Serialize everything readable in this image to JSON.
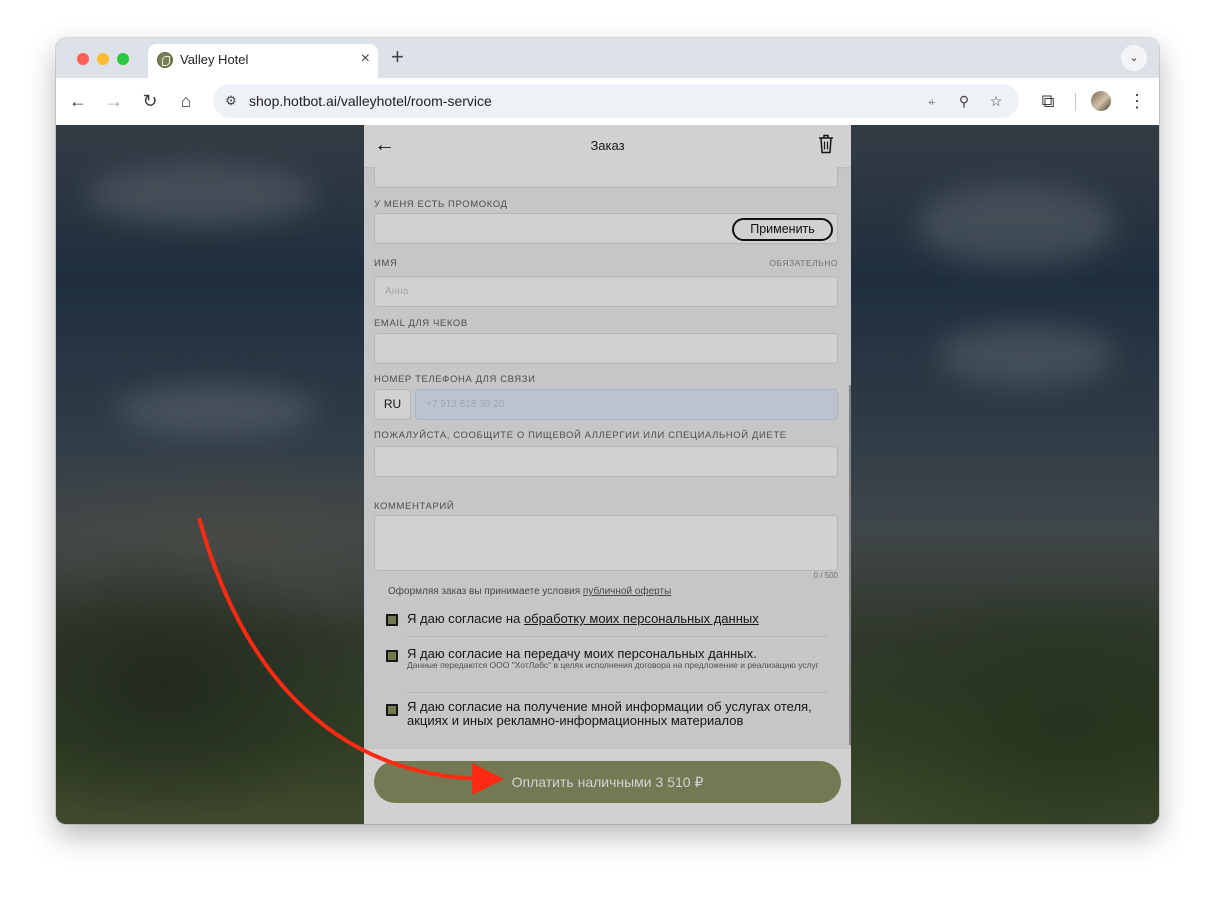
{
  "browser": {
    "tab_title": "Valley Hotel",
    "tab_close": "×",
    "new_tab": "+",
    "url": "shop.hotbot.ai/valleyhotel/room-service"
  },
  "icons": {
    "back": "←",
    "forward": "→",
    "reload": "↻",
    "home": "⌂",
    "translate": "⍅",
    "zoom": "⚲",
    "bookmark": "☆",
    "extensions": "⧉",
    "menu": "⋮",
    "tab_menu": "⌄",
    "tune": "⚙"
  },
  "order": {
    "title": "Заказ",
    "back_arrow": "←",
    "promo_label": "У МЕНЯ ЕСТЬ ПРОМОКОД",
    "promo_value": "",
    "apply_button": "Применить",
    "name_label": "ИМЯ",
    "required": "ОБЯЗАТЕЛЬНО",
    "name_placeholder": "Анна",
    "email_label": "EMAIL ДЛЯ ЧЕКОВ",
    "email_value": "",
    "phone_label": "НОМЕР ТЕЛЕФОНА ДЛЯ СВЯЗИ",
    "country_code": "RU",
    "phone_placeholder": "+7 913 618 30 20",
    "allergy_label": "ПОЖАЛУЙСТА, СООБЩИТЕ О ПИЩЕВОЙ АЛЛЕРГИИ ИЛИ СПЕЦИАЛЬНОЙ ДИЕТЕ",
    "allergy_value": "",
    "comment_label": "КОММЕНТАРИЙ",
    "comment_value": "",
    "comment_counter": "0 / 500",
    "offer_prefix": "Оформляя заказ вы принимаете условия ",
    "offer_link": "публичной оферты",
    "consent1_prefix": "Я даю согласие на ",
    "consent1_link": "обработку моих персональных данных",
    "consent2": "Я даю согласие на передачу моих персональных данных.",
    "consent2_note": "Данные передаются ООО \"ХотЛабс\" в целях исполнения договора на предложение и реализацию услуг",
    "consent3": "Я даю согласие на получение мной информации об услугах отеля, акциях и иных рекламно-информационных материалов",
    "pay_button": "Оплатить наличными 3 510 ₽"
  },
  "colors": {
    "accent_olive": "#8e9467",
    "annotation_arrow": "#ff2a12"
  }
}
